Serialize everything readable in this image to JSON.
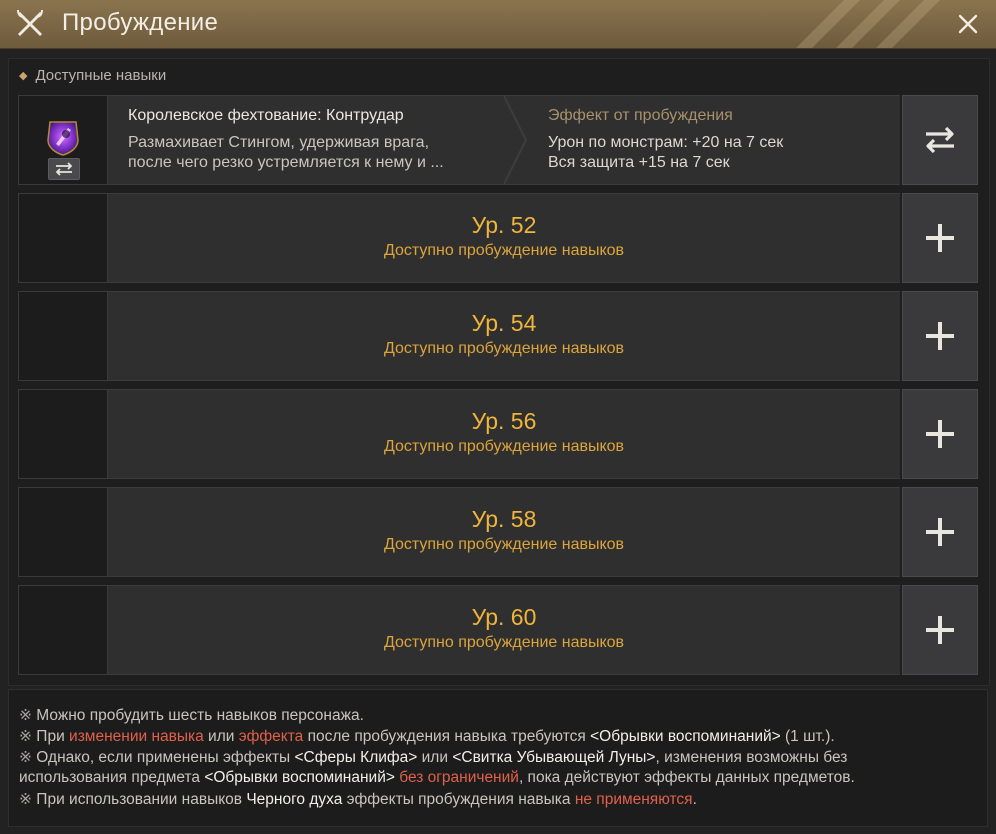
{
  "window": {
    "title": "Пробуждение"
  },
  "section": {
    "label": "Доступные навыки"
  },
  "skill": {
    "name": "Королевское фехтование: Контрудар",
    "desc_line1": "Размахивает Стингом, удерживая врага,",
    "desc_line2": "после чего резко устремляется к нему и ...",
    "effect_title": "Эффект от пробуждения",
    "effect_line1": "Урон по монстрам: +20 на 7 сек",
    "effect_line2": "Вся защита +15 на 7 сек"
  },
  "slots": [
    {
      "level": "Ур. 52",
      "status": "Доступно пробуждение навыков"
    },
    {
      "level": "Ур. 54",
      "status": "Доступно пробуждение навыков"
    },
    {
      "level": "Ур. 56",
      "status": "Доступно пробуждение навыков"
    },
    {
      "level": "Ур. 58",
      "status": "Доступно пробуждение навыков"
    },
    {
      "level": "Ур. 60",
      "status": "Доступно пробуждение навыков"
    }
  ],
  "notes": {
    "mark": "※",
    "n1": " Можно пробудить шесть навыков персонажа.",
    "n2_a": " При ",
    "n2_b": "изменении навыка",
    "n2_c": " или ",
    "n2_d": "эффекта",
    "n2_e": " после пробуждения навыка требуются ",
    "n2_f": "<Обрывки воспоминаний>",
    "n2_g": " (1 шт.).",
    "n3_a": " Однако, если применены эффекты ",
    "n3_b": "<Сферы Клифа>",
    "n3_c": " или ",
    "n3_d": "<Свитка Убывающей Луны>",
    "n3_e": ", изменения возможны без",
    "n4_a": "использования предмета ",
    "n4_b": "<Обрывки воспоминаний>",
    "n4_c": " ",
    "n4_d": "без ограничений",
    "n4_e": ", пока действуют эффекты данных предметов.",
    "n5_a": " При использовании навыков ",
    "n5_b": "Черного духа",
    "n5_c": " эффекты пробуждения навыка ",
    "n5_d": "не применяются",
    "n5_e": "."
  },
  "colors": {
    "accent_gold": "#f0b53a",
    "warning_red": "#e0604a",
    "titlebar": "#7a6644"
  },
  "icons": {
    "title": "crossed-axe-sword-icon",
    "close": "close-icon",
    "swap": "swap-arrows-icon",
    "add": "plus-icon",
    "skill": "purple-skill-icon",
    "section_bullet": "diamond-bullet-icon"
  }
}
